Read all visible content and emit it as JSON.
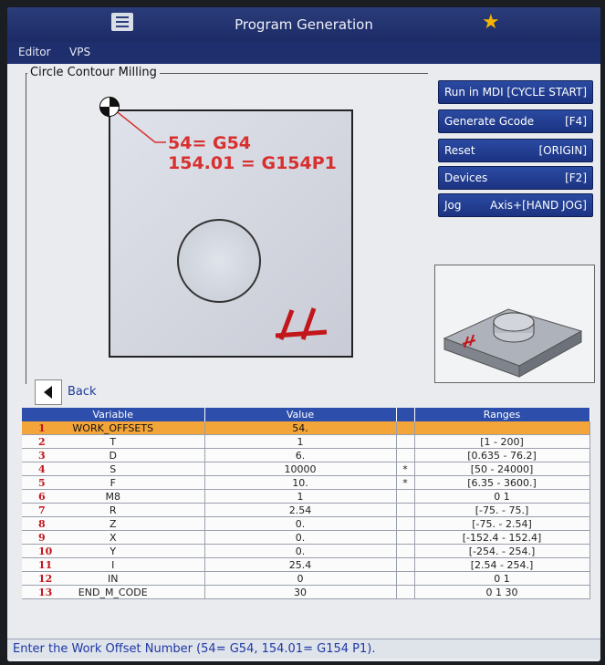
{
  "window": {
    "title": "Program Generation"
  },
  "tabs": [
    "Editor",
    "VPS"
  ],
  "group": {
    "label": "Circle Contour Milling"
  },
  "preview": {
    "note_line1": "54= G54",
    "note_line2": "154.01 = G154P1"
  },
  "buttons": [
    {
      "left": "Run in MDI",
      "right": "[CYCLE START]"
    },
    {
      "left": "Generate Gcode",
      "right": "[F4]"
    },
    {
      "left": "Reset",
      "right": "[ORIGIN]"
    },
    {
      "left": "Devices",
      "right": "[F2]"
    },
    {
      "left": "Jog",
      "right": "Axis+[HAND JOG]"
    }
  ],
  "back": {
    "label": "Back"
  },
  "table": {
    "headers": [
      "Variable",
      "Value",
      "",
      "Ranges"
    ],
    "rows": [
      {
        "num": "1",
        "variable": "WORK_OFFSETS",
        "value": "54.",
        "flag": "",
        "range": ""
      },
      {
        "num": "2",
        "variable": "T",
        "value": "1",
        "flag": "",
        "range": "[1 - 200]"
      },
      {
        "num": "3",
        "variable": "D",
        "value": "6.",
        "flag": "",
        "range": "[0.635 - 76.2]"
      },
      {
        "num": "4",
        "variable": "S",
        "value": "10000",
        "flag": "*",
        "range": "[50 - 24000]"
      },
      {
        "num": "5",
        "variable": "F",
        "value": "10.",
        "flag": "*",
        "range": "[6.35 - 3600.]"
      },
      {
        "num": "6",
        "variable": "M8",
        "value": "1",
        "flag": "",
        "range": "0 1"
      },
      {
        "num": "7",
        "variable": "R",
        "value": "2.54",
        "flag": "",
        "range": "[-75. - 75.]"
      },
      {
        "num": "8",
        "variable": "Z",
        "value": "0.",
        "flag": "",
        "range": "[-75. - 2.54]"
      },
      {
        "num": "9",
        "variable": "X",
        "value": "0.",
        "flag": "",
        "range": "[-152.4 - 152.4]"
      },
      {
        "num": "10",
        "variable": "Y",
        "value": "0.",
        "flag": "",
        "range": "[-254. - 254.]"
      },
      {
        "num": "11",
        "variable": "I",
        "value": "25.4",
        "flag": "",
        "range": "[2.54 - 254.]"
      },
      {
        "num": "12",
        "variable": "IN",
        "value": "0",
        "flag": "",
        "range": "0 1"
      },
      {
        "num": "13",
        "variable": "END_M_CODE",
        "value": "30",
        "flag": "",
        "range": "0 1 30"
      }
    ]
  },
  "status": {
    "text": "Enter the Work Offset Number (54= G54, 154.01= G154 P1)."
  },
  "icons": {
    "menu": "hamburger-menu-icon",
    "favorite": "star-icon",
    "back": "back-arrow-icon"
  },
  "colors": {
    "accent": "#1c3382",
    "selected_row": "#f3a53a",
    "annotation": "#d8302e"
  }
}
